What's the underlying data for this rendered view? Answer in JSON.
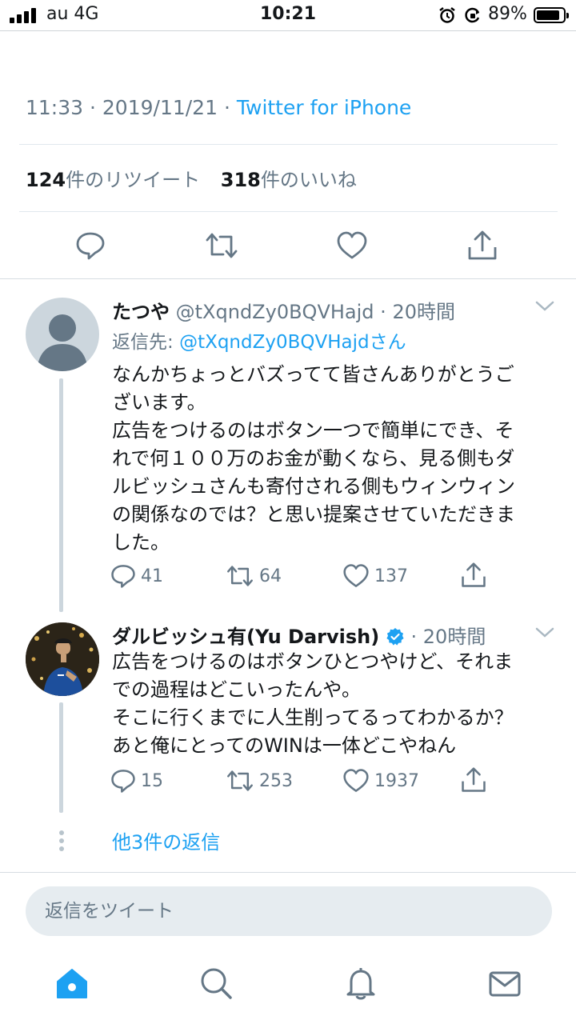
{
  "status_bar": {
    "carrier": "au 4G",
    "time": "10:21",
    "battery_percent": "89%",
    "battery_level": 0.89
  },
  "tweet": {
    "time": "11:33",
    "date": "2019/11/21",
    "source": "Twitter for iPhone",
    "retweet_count": "124",
    "retweet_label": "件のリツイート",
    "like_count": "318",
    "like_label": "件のいいね"
  },
  "replies": [
    {
      "name": "たつや",
      "handle": "@tXqndZy0BQVHajd",
      "age": "20時間",
      "reply_to_label": "返信先:",
      "reply_to_handle": "@tXqndZy0BQVHajdさん",
      "text": "なんかちょっとバズってて皆さんありがとうご\nざいます。\n広告をつけるのはボタン一つで簡単にでき、そ\nれで何１００万のお金が動くなら、見る側もダ\nルビッシュさんも寄付される側もウィンウィン\nの関係なのでは？と思い提案させていただきま\nした。",
      "replies": "41",
      "retweets": "64",
      "likes": "137"
    },
    {
      "name": "ダルビッシュ有(Yu Darvish)",
      "handle": "",
      "age": "20時間",
      "verified": true,
      "text": "広告をつけるのはボタンひとつやけど、それま\nでの過程はどこいったんや。\nそこに行くまでに人生削ってるってわかるか？\nあと俺にとってのWINは一体どこやねん",
      "replies": "15",
      "retweets": "253",
      "likes": "1937"
    }
  ],
  "more_replies": "他3件の返信",
  "compose": {
    "placeholder": "返信をツイート"
  },
  "nav": [
    "home-icon",
    "search-icon",
    "notifications-icon",
    "messages-icon"
  ],
  "colors": {
    "accent": "#1da1f2",
    "muted": "#657786",
    "text": "#14171a",
    "divider": "#e1e8ed"
  }
}
